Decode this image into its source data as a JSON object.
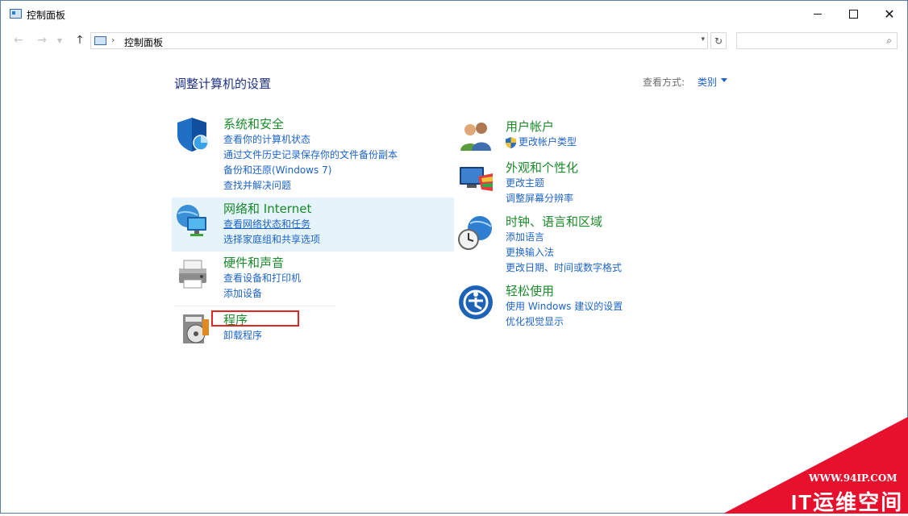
{
  "window": {
    "title": "控制面板",
    "minimize": "minimize",
    "maximize": "maximize",
    "close": "✕"
  },
  "address": {
    "breadcrumb": "控制面板",
    "separator": "›",
    "search_placeholder": ""
  },
  "header": {
    "title": "调整计算机的设置",
    "view_by_label": "查看方式:",
    "view_by_value": "类别"
  },
  "left_categories": [
    {
      "title": "系统和安全",
      "links": [
        "查看你的计算机状态",
        "通过文件历史记录保存你的文件备份副本",
        "备份和还原(Windows 7)",
        "查找并解决问题"
      ]
    },
    {
      "title": "网络和 Internet",
      "links": [
        "查看网络状态和任务",
        "选择家庭组和共享选项"
      ]
    },
    {
      "title": "硬件和声音",
      "links": [
        "查看设备和打印机",
        "添加设备"
      ]
    },
    {
      "title": "程序",
      "links": [
        "卸载程序"
      ]
    }
  ],
  "right_categories": [
    {
      "title": "用户帐户",
      "links": [
        "更改帐户类型"
      ]
    },
    {
      "title": "外观和个性化",
      "links": [
        "更改主题",
        "调整屏幕分辨率"
      ]
    },
    {
      "title": "时钟、语言和区域",
      "links": [
        "添加语言",
        "更换输入法",
        "更改日期、时间或数字格式"
      ]
    },
    {
      "title": "轻松使用",
      "links": [
        "使用 Windows 建议的设置",
        "优化视觉显示"
      ]
    }
  ],
  "watermark": {
    "url": "WWW.94IP.COM",
    "brand": "IT运维空间",
    "color": "#e8112d"
  },
  "colors": {
    "category_title": "#1a8a2a",
    "link": "#1e64c8",
    "heading": "#1e3287",
    "highlight": "#e5f3fb",
    "annotation_box": "#e02626"
  }
}
